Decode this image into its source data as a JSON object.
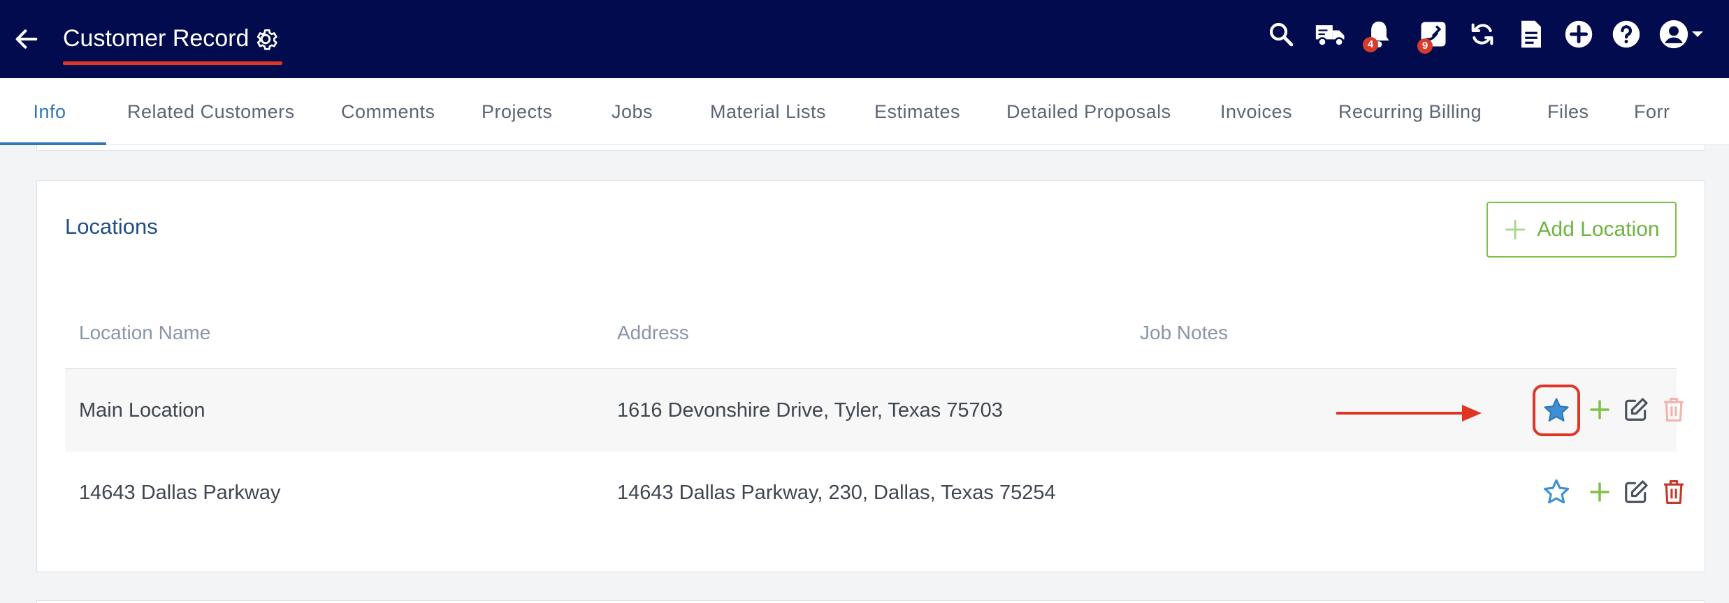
{
  "header": {
    "title": "Customer Record",
    "notifications_badge": "4",
    "messages_badge": "9",
    "icons": [
      "back-arrow-icon",
      "gear-icon",
      "search-icon",
      "delivery-truck-icon",
      "bell-icon",
      "phone-check-icon",
      "sync-icon",
      "document-icon",
      "plus-circle-icon",
      "help-icon",
      "user-account-icon",
      "chevron-down-icon"
    ]
  },
  "tabs": [
    {
      "label": "Info",
      "active": true
    },
    {
      "label": "Related Customers"
    },
    {
      "label": "Comments"
    },
    {
      "label": "Projects"
    },
    {
      "label": "Jobs"
    },
    {
      "label": "Material Lists"
    },
    {
      "label": "Estimates"
    },
    {
      "label": "Detailed Proposals"
    },
    {
      "label": "Invoices"
    },
    {
      "label": "Recurring Billing"
    },
    {
      "label": "Files"
    },
    {
      "label": "Forr"
    }
  ],
  "locations": {
    "title": "Locations",
    "add_button": "Add Location",
    "columns": [
      "Location Name",
      "Address",
      "Job Notes"
    ],
    "rows": [
      {
        "name": "Main Location",
        "address": "1616 Devonshire Drive, Tyler, Texas 75703",
        "notes": "",
        "primary": true
      },
      {
        "name": "14643 Dallas Parkway",
        "address": "14643 Dallas Parkway, 230, Dallas, Texas 75254",
        "notes": "",
        "primary": false
      }
    ]
  },
  "colors": {
    "header_bg": "#020b4d",
    "accent_blue": "#2e78b6",
    "add_green": "#7dc242",
    "delete_red": "#c0392b",
    "annotation_red": "#e03525"
  }
}
